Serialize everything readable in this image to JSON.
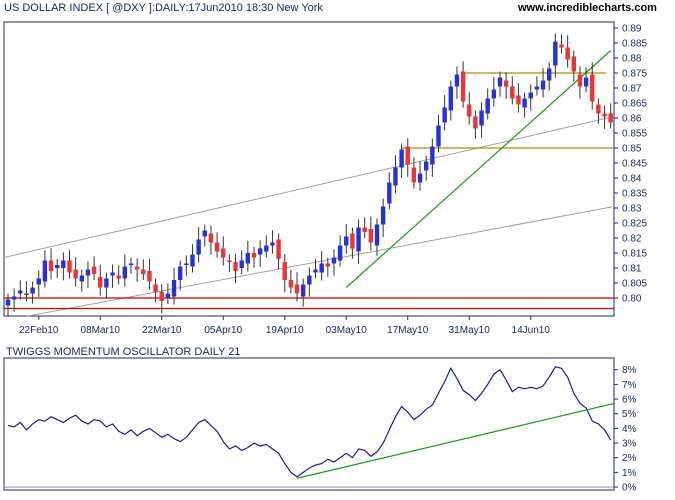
{
  "header": {
    "title": "US DOLLAR INDEX [ @DXY ]:DAILY:17Jun2010 18:30 New York",
    "site": "www.incrediblecharts.com"
  },
  "colors": {
    "up": "#2233dd",
    "down": "#ee3333",
    "trendline": "#1a9a1a",
    "channel": "#a0a0a0",
    "resistance": "#b8860b",
    "support": "#cc0000",
    "oscillator": "#1a1aa8",
    "border": "#1a2a6b"
  },
  "chart_data": [
    {
      "type": "candlestick",
      "title": "US DOLLAR INDEX [ @DXY ]:DAILY:17Jun2010 18:30 New York",
      "x_tick_labels": [
        "22Feb10",
        "08Mar10",
        "22Mar10",
        "05Apr10",
        "19Apr10",
        "03May10",
        "17May10",
        "31May10",
        "14Jun10"
      ],
      "y_tick_labels": [
        "0.80",
        "0.805",
        "0.81",
        "0.815",
        "0.82",
        "0.825",
        "0.83",
        "0.835",
        "0.84",
        "0.845",
        "0.85",
        "0.855",
        "0.86",
        "0.865",
        "0.87",
        "0.875",
        "0.88",
        "0.885",
        "0.89"
      ],
      "ylim": [
        0.794,
        0.892
      ],
      "grid": false,
      "close": [
        0.7995,
        0.8005,
        0.8025,
        0.8015,
        0.8035,
        0.8065,
        0.8125,
        0.809,
        0.811,
        0.8125,
        0.8085,
        0.8065,
        0.8075,
        0.8095,
        0.808,
        0.8035,
        0.8065,
        0.8085,
        0.8065,
        0.8105,
        0.8115,
        0.8095,
        0.808,
        0.8055,
        0.802,
        0.799,
        0.8015,
        0.806,
        0.8105,
        0.8115,
        0.8145,
        0.8195,
        0.8225,
        0.8185,
        0.8155,
        0.8135,
        0.812,
        0.809,
        0.8125,
        0.815,
        0.8135,
        0.8165,
        0.8175,
        0.8185,
        0.813,
        0.806,
        0.8035,
        0.8015,
        0.8045,
        0.8075,
        0.8095,
        0.8115,
        0.8105,
        0.8135,
        0.8175,
        0.8205,
        0.8165,
        0.8235,
        0.822,
        0.8185,
        0.8245,
        0.8305,
        0.8385,
        0.8435,
        0.8495,
        0.8445,
        0.8385,
        0.8415,
        0.8455,
        0.8505,
        0.8575,
        0.8635,
        0.8705,
        0.8745,
        0.8655,
        0.8605,
        0.8565,
        0.8625,
        0.8665,
        0.8695,
        0.8735,
        0.8705,
        0.8665,
        0.8645,
        0.8665,
        0.8685,
        0.8705,
        0.8725,
        0.8765,
        0.8855,
        0.8835,
        0.8795,
        0.8755,
        0.8705,
        0.8735,
        0.8655,
        0.8615,
        0.8605,
        0.8585
      ],
      "reference_lines": [
        {
          "kind": "resistance",
          "level": 0.875
        },
        {
          "kind": "support",
          "level": 0.85
        },
        {
          "kind": "support",
          "level": 0.8
        },
        {
          "kind": "support",
          "level": 0.7965
        }
      ]
    },
    {
      "type": "line",
      "title": "TWIGGS MOMENTUM OSCILLATOR DAILY 21",
      "y_tick_labels": [
        "0%",
        "1%",
        "2%",
        "3%",
        "4%",
        "5%",
        "6%",
        "7%",
        "8%"
      ],
      "ylim": [
        -0.2,
        8.8
      ],
      "series": [
        {
          "values": [
            4.2,
            4.1,
            4.4,
            3.9,
            4.3,
            4.6,
            4.5,
            4.8,
            4.6,
            4.4,
            4.7,
            4.9,
            4.5,
            4.3,
            4.6,
            4.5,
            4.1,
            4.3,
            3.8,
            3.6,
            3.9,
            3.5,
            3.8,
            4.0,
            3.7,
            3.4,
            3.6,
            3.3,
            3.1,
            3.4,
            3.9,
            4.4,
            4.6,
            4.2,
            3.8,
            3.1,
            2.6,
            2.8,
            2.5,
            2.7,
            3.0,
            2.8,
            2.9,
            2.6,
            2.3,
            1.6,
            1.0,
            0.7,
            1.0,
            1.3,
            1.5,
            1.6,
            1.9,
            1.7,
            2.0,
            2.3,
            2.0,
            2.6,
            2.5,
            2.1,
            2.4,
            3.0,
            3.9,
            4.8,
            5.5,
            5.1,
            4.6,
            4.9,
            5.3,
            5.6,
            6.4,
            7.2,
            8.1,
            7.4,
            6.6,
            6.3,
            5.9,
            6.4,
            7.0,
            7.7,
            8.0,
            7.3,
            6.5,
            6.8,
            6.7,
            6.8,
            6.7,
            6.9,
            7.5,
            8.2,
            8.1,
            7.5,
            6.4,
            5.7,
            5.4,
            4.5,
            4.3,
            3.9,
            3.2
          ]
        }
      ]
    }
  ]
}
